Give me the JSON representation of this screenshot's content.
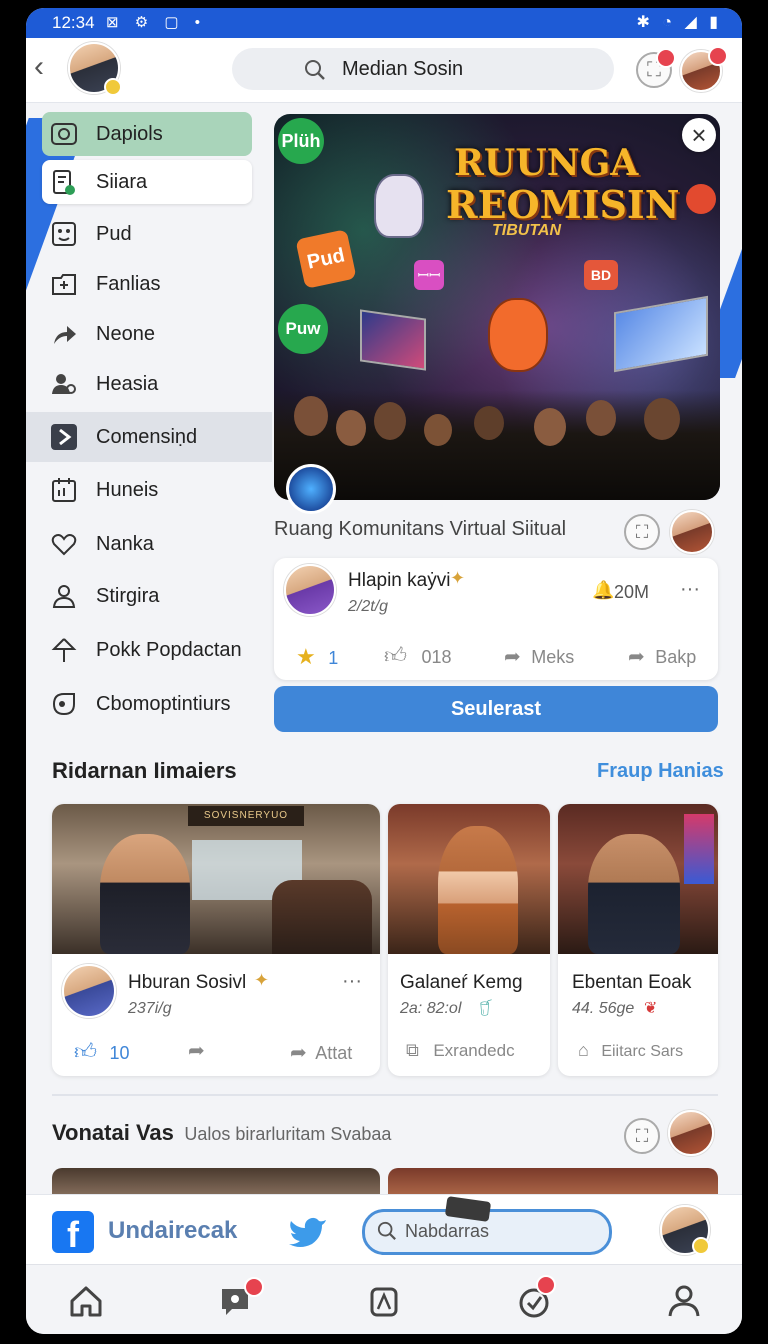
{
  "status": {
    "time": "12:34",
    "left_icons": "⊠ ⚙ ▢ •",
    "right_icons": "✱ ◔ ◢ ▮"
  },
  "top": {
    "search_text": "Median Sosin"
  },
  "sidebar": {
    "items": [
      {
        "label": "Dapiols",
        "icon": "camera-icon"
      },
      {
        "label": "Siiara",
        "icon": "document-icon"
      },
      {
        "label": "Pud",
        "icon": "face-icon"
      },
      {
        "label": "Fanlias",
        "icon": "folder-icon"
      },
      {
        "label": "Neone",
        "icon": "share-icon"
      },
      {
        "label": "Heasia",
        "icon": "people-icon"
      },
      {
        "label": "Comensiṇd",
        "icon": "play-icon"
      },
      {
        "label": "Huneis",
        "icon": "calendar-icon"
      },
      {
        "label": "Nanka",
        "icon": "heart-icon"
      },
      {
        "label": "Stirgira",
        "icon": "person-icon"
      },
      {
        "label": "Pokk Popdactan",
        "icon": "pin-icon"
      },
      {
        "label": "Cbomoptintiurs",
        "icon": "tag-icon"
      }
    ]
  },
  "hero": {
    "title_line1": "RUUNGA",
    "title_line2": "REOMISIN",
    "title_line3": "TIBUTAN",
    "sign_left": "Plüh",
    "sign_pud": "Pud",
    "sign_puw": "Puw",
    "sign_ao": "ꟷꟷ",
    "sign_bd": "BD",
    "caption": "Ruang Komunitans Virtual Siitual"
  },
  "post": {
    "name": "Hlapin kaẏvi",
    "sub": "2/2t/g",
    "count": "20M",
    "more": "···",
    "actions": [
      "1",
      "018",
      "Meks",
      "Bakp"
    ],
    "cta": "Seulerast"
  },
  "section1": {
    "title": "Ridarnan Iimaiers",
    "link": "Fraup Hanias",
    "photo_sign": "SOVISNERYUO",
    "cards": [
      {
        "name": "Hburan Sosivl",
        "sub": "237i/g",
        "more": "···",
        "actions": [
          "10",
          "",
          "Attat"
        ]
      },
      {
        "name": "Galaneŕ Kemg",
        "sub": "2a: 82:ol",
        "actions": [
          "Exrandedc"
        ]
      },
      {
        "name": "Ebentan Eoak",
        "sub": "44. 56ge",
        "actions": [
          "Eiitarc Sars"
        ]
      }
    ]
  },
  "section2": {
    "title": "Vonatai Vas",
    "subtitle": "Ualos birarluritam Svabaa"
  },
  "bottom": {
    "fb_letter": "f",
    "fb_text": "Undairecak",
    "search_placeholder": "Nabdarras"
  },
  "colors": {
    "accent": "#3f86d8",
    "status_bar": "#1e5bd6",
    "facebook": "#1877f2",
    "alert": "#e6434f"
  }
}
